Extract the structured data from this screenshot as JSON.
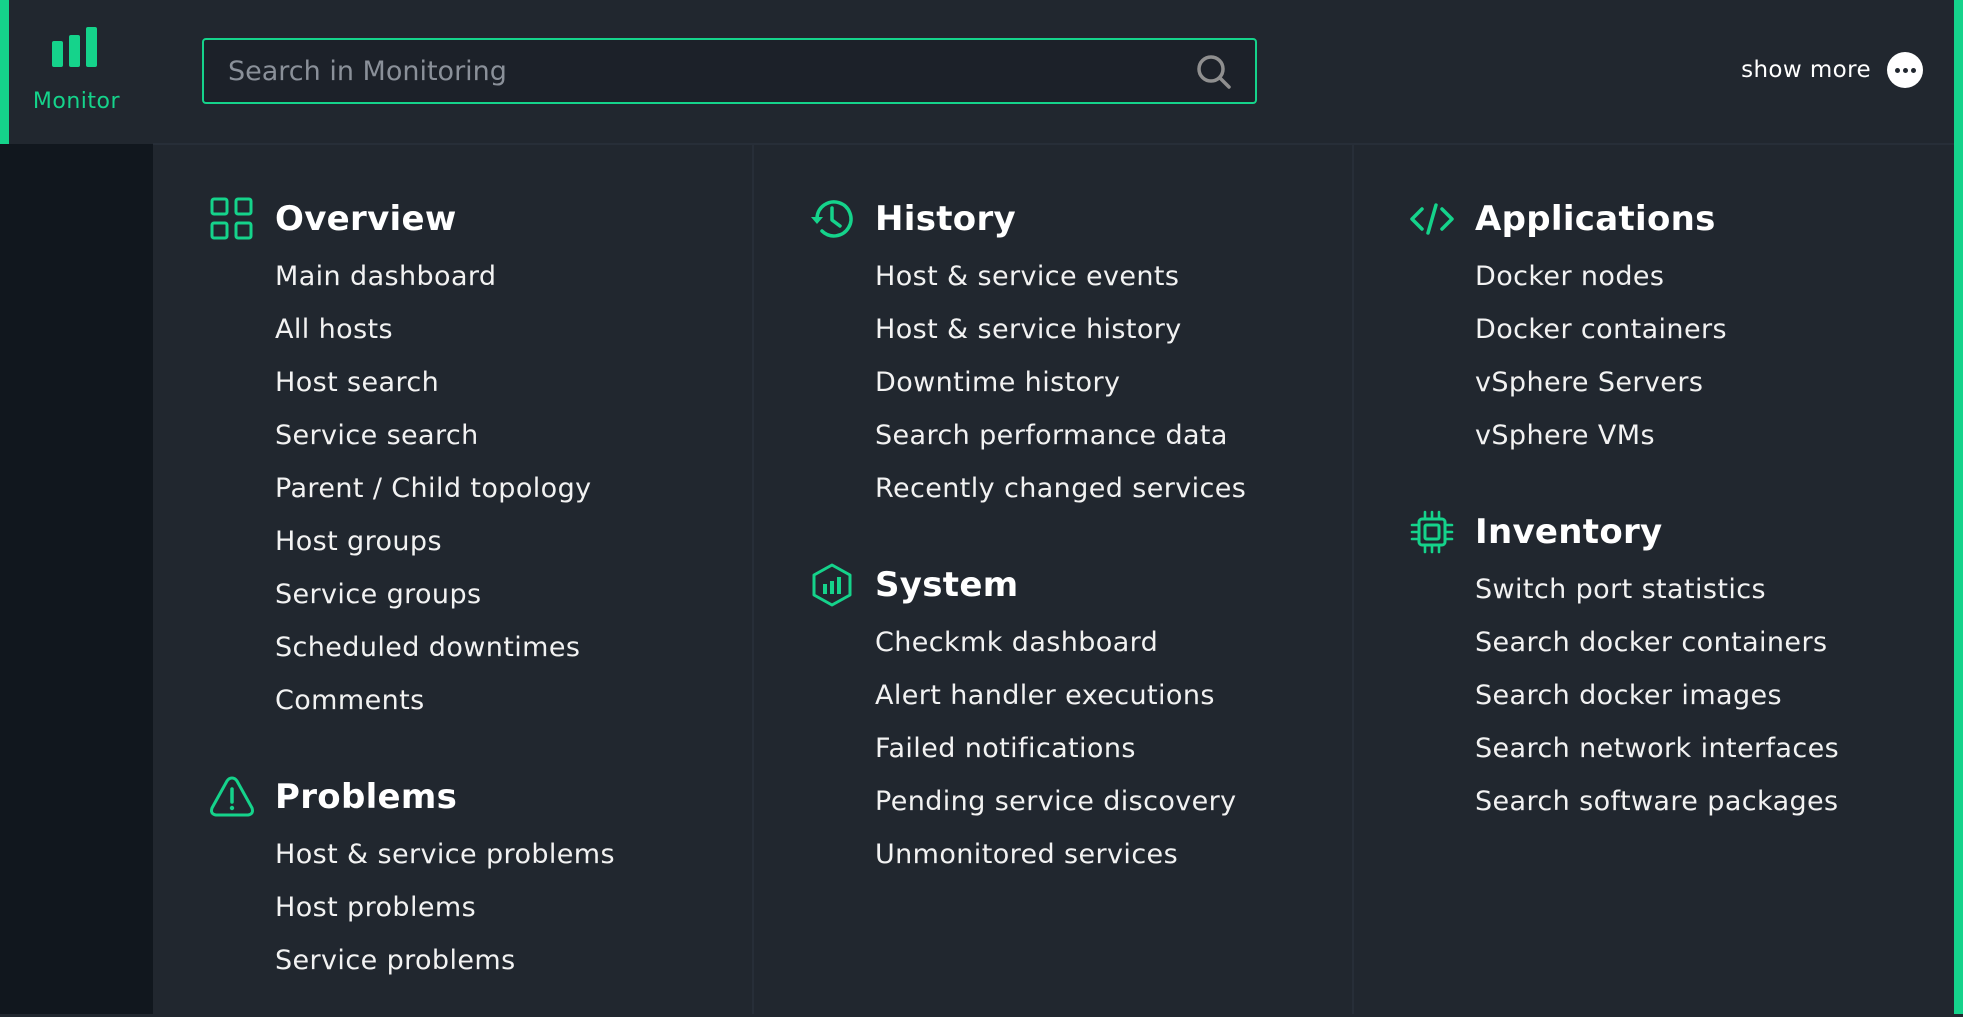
{
  "nav": {
    "active_label": "Monitor",
    "accent_color": "#15d38b"
  },
  "search": {
    "placeholder": "Search in Monitoring",
    "value": ""
  },
  "header": {
    "show_more_label": "show more"
  },
  "columns": [
    {
      "sections": [
        {
          "title": "Overview",
          "icon": "grid-icon",
          "items": [
            "Main dashboard",
            "All hosts",
            "Host search",
            "Service search",
            "Parent / Child topology",
            "Host groups",
            "Service groups",
            "Scheduled downtimes",
            "Comments"
          ]
        },
        {
          "title": "Problems",
          "icon": "warning-icon",
          "items": [
            "Host & service problems",
            "Host problems",
            "Service problems"
          ]
        }
      ]
    },
    {
      "sections": [
        {
          "title": "History",
          "icon": "history-icon",
          "items": [
            "Host & service events",
            "Host & service history",
            "Downtime history",
            "Search performance data",
            "Recently changed services"
          ]
        },
        {
          "title": "System",
          "icon": "system-icon",
          "items": [
            "Checkmk dashboard",
            "Alert handler executions",
            "Failed notifications",
            "Pending service discovery",
            "Unmonitored services"
          ]
        }
      ]
    },
    {
      "sections": [
        {
          "title": "Applications",
          "icon": "code-icon",
          "items": [
            "Docker nodes",
            "Docker containers",
            "vSphere Servers",
            "vSphere VMs"
          ]
        },
        {
          "title": "Inventory",
          "icon": "chip-icon",
          "items": [
            "Switch port statistics",
            "Search docker containers",
            "Search docker images",
            "Search network interfaces",
            "Search software packages"
          ]
        }
      ]
    }
  ]
}
